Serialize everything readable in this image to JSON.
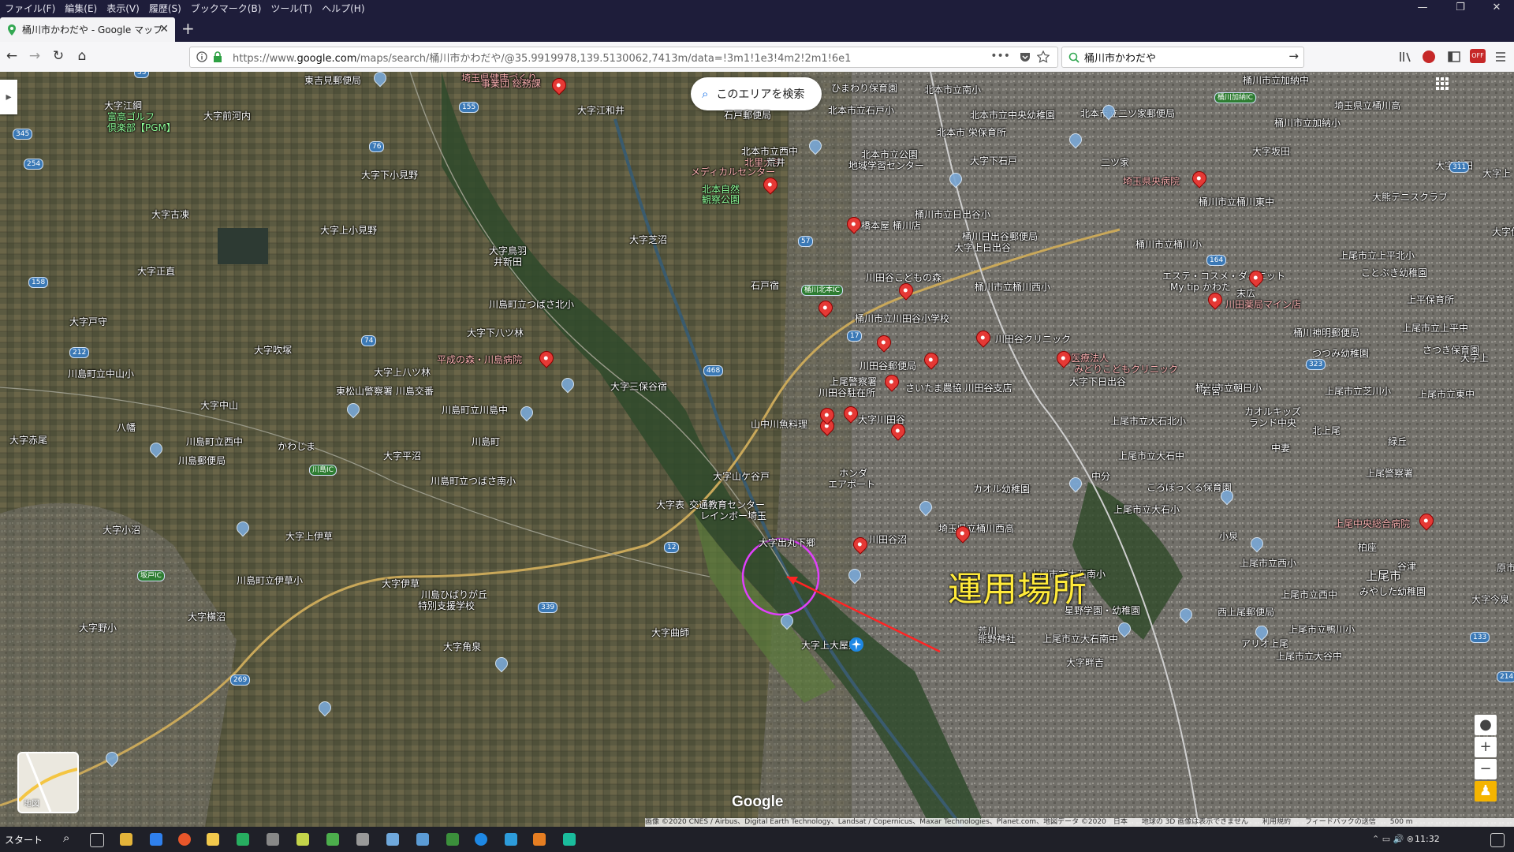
{
  "menu": [
    "ファイル(F)",
    "編集(E)",
    "表示(V)",
    "履歴(S)",
    "ブックマーク(B)",
    "ツール(T)",
    "ヘルプ(H)"
  ],
  "window_controls": {
    "minimize": "—",
    "restore": "❐",
    "close": "✕"
  },
  "tab": {
    "title": "桶川市かわだや - Google マップ",
    "close": "✕",
    "new_tab": "+"
  },
  "nav": {
    "back": "←",
    "forward": "→",
    "reload": "↻",
    "home": "⌂"
  },
  "address": {
    "url_prefix": "https://www.",
    "url_domain": "google.com",
    "url_rest": "/maps/search/桶川市かわだや/@35.9919978,139.5130062,7413m/data=!3m1!1e3!4m2!2m1!6e1"
  },
  "search": {
    "value": "桶川市かわだや",
    "go": "→"
  },
  "map": {
    "search_area_button": "このエリアを検索",
    "annotation": "運用場所",
    "google": "Google",
    "layer_label": "地図",
    "attribution": "画像 ©2020 CNES / Airbus、Digital Earth Technology、Landsat / Copernicus、Maxar Technologies、Planet.com、地図データ ©2020　日本　　地球の 3D 画像は表示できません　　利用規約　　フィードバックの送信　　500 m",
    "zoom_in": "+",
    "zoom_out": "−",
    "labels": [
      {
        "t": "東吉見郵便局"
      },
      {
        "t": "埼玉県健康づくり"
      },
      {
        "t": "事業団 総務課"
      },
      {
        "t": "大字江綱"
      },
      {
        "t": "富高ゴルフ"
      },
      {
        "t": "倶楽部【PGM】"
      },
      {
        "t": "大字前河内"
      },
      {
        "t": "大字江和井"
      },
      {
        "t": "石戸郵便局"
      },
      {
        "t": "北本市立石戸小"
      },
      {
        "t": "北本市立西中"
      },
      {
        "t": "北里大学"
      },
      {
        "t": "メディカルセンター"
      },
      {
        "t": "北本自然"
      },
      {
        "t": "観察公園"
      },
      {
        "t": "大字下小見野"
      },
      {
        "t": "大字古凍"
      },
      {
        "t": "大字上小見野"
      },
      {
        "t": "大字鳥羽"
      },
      {
        "t": "井新田"
      },
      {
        "t": "大字芝沼"
      },
      {
        "t": "橋本屋 桶川店"
      },
      {
        "t": "大字正直"
      },
      {
        "t": "川島町立つばさ北小"
      },
      {
        "t": "大字下八ツ林"
      },
      {
        "t": "平成の森・川島病院"
      },
      {
        "t": "大字戸守"
      },
      {
        "t": "大字吹塚"
      },
      {
        "t": "大字上八ツ林"
      },
      {
        "t": "川島町立中山小"
      },
      {
        "t": "東松山警察署 川島交番"
      },
      {
        "t": "大字中山"
      },
      {
        "t": "川島町立川島中"
      },
      {
        "t": "大字三保谷宿"
      },
      {
        "t": "山中川魚料理"
      },
      {
        "t": "大字赤尾"
      },
      {
        "t": "川島町立西中"
      },
      {
        "t": "かわじま"
      },
      {
        "t": "川島郵便局"
      },
      {
        "t": "大字平沼"
      },
      {
        "t": "川島町"
      },
      {
        "t": "川島町立つばさ南小"
      },
      {
        "t": "大字山ケ谷戸"
      },
      {
        "t": "大字表"
      },
      {
        "t": "交通教育センター"
      },
      {
        "t": "レインボー埼玉"
      },
      {
        "t": "ホンダ"
      },
      {
        "t": "エアポート"
      },
      {
        "t": "大字小沼"
      },
      {
        "t": "大字上伊草"
      },
      {
        "t": "大字出丸下郷"
      },
      {
        "t": "川田谷沼"
      },
      {
        "t": "川島町立伊草小"
      },
      {
        "t": "大字伊草"
      },
      {
        "t": "川島ひばりが丘"
      },
      {
        "t": "特別支援学校"
      },
      {
        "t": "大字横沼"
      },
      {
        "t": "大字曲師"
      },
      {
        "t": "大字上大屋敷"
      },
      {
        "t": "大字角泉"
      },
      {
        "t": "大字野小"
      },
      {
        "t": "北本市立公園"
      },
      {
        "t": "地域学習センター"
      },
      {
        "t": "北本市 栄保育所"
      },
      {
        "t": "北本市立中央幼稚園"
      },
      {
        "t": "北本市立南小"
      },
      {
        "t": "北本市立二ツ家郵便局"
      },
      {
        "t": "ひまわり保育園"
      },
      {
        "t": "大字下石戸"
      },
      {
        "t": "桶川市立日出谷小"
      },
      {
        "t": "桶川日出谷郵便局"
      },
      {
        "t": "大字上日出谷"
      },
      {
        "t": "川田谷こどもの森"
      },
      {
        "t": "桶川市立桶川西小"
      },
      {
        "t": "桶川市立川田谷小学校"
      },
      {
        "t": "川田谷クリニック"
      },
      {
        "t": "川田谷郵便局"
      },
      {
        "t": "上尾警察署"
      },
      {
        "t": "川田谷駐在所"
      },
      {
        "t": "さいたま農協 川田谷支店"
      },
      {
        "t": "大字川田谷"
      },
      {
        "t": "埼玉県立桶川西高"
      },
      {
        "t": "カオル幼稚園"
      },
      {
        "t": "熊野神社"
      },
      {
        "t": "医療法人"
      },
      {
        "t": "みどりこどもクリニック"
      },
      {
        "t": "大字下日出谷"
      },
      {
        "t": "桶川市立桶川小"
      },
      {
        "t": "埼玉県央病院"
      },
      {
        "t": "エステ・コスメ・ダイエット"
      },
      {
        "t": "My tip かわた"
      },
      {
        "t": "川田薬局マイン店"
      },
      {
        "t": "桶川神明郵便局"
      },
      {
        "t": "つつみ幼稚園"
      },
      {
        "t": "桶川市立朝日小"
      },
      {
        "t": "カオルキッズ"
      },
      {
        "t": "ランド中央"
      },
      {
        "t": "上尾市立大石北小"
      },
      {
        "t": "上尾市立大石中"
      },
      {
        "t": "ころぽっくる保育園"
      },
      {
        "t": "上尾市立大石小"
      },
      {
        "t": "上尾市立大石南小"
      },
      {
        "t": "星野学園・幼稚園"
      },
      {
        "t": "上尾市立大石南中"
      },
      {
        "t": "大字畔吉"
      },
      {
        "t": "桶川市立加納中"
      },
      {
        "t": "埼玉県立桶川高"
      },
      {
        "t": "桶川市立加納小"
      },
      {
        "t": "大字坂田"
      },
      {
        "t": "大字倉田"
      },
      {
        "t": "大熊テニスクラブ"
      },
      {
        "t": "桶川市立桶川東中"
      },
      {
        "t": "上尾市立上平北小"
      },
      {
        "t": "ことぶき幼稚園"
      },
      {
        "t": "上平保育所"
      },
      {
        "t": "上尾市立上平中"
      },
      {
        "t": "さつき保育園"
      },
      {
        "t": "上尾市立芝川小"
      },
      {
        "t": "上尾市立東中"
      },
      {
        "t": "上尾警察署"
      },
      {
        "t": "上尾中央総合病院"
      },
      {
        "t": "上尾市立西小"
      },
      {
        "t": "上尾市立西中"
      },
      {
        "t": "みやした幼稚園"
      },
      {
        "t": "西上尾郵便局"
      },
      {
        "t": "上尾市立鴨川小"
      },
      {
        "t": "アリオ上尾"
      },
      {
        "t": "上尾市立大谷中"
      },
      {
        "t": "上尾市"
      },
      {
        "t": "北上尾"
      },
      {
        "t": "二ツ家"
      },
      {
        "t": "若宮"
      },
      {
        "t": "末広"
      },
      {
        "t": "大字上"
      },
      {
        "t": "石戸宿"
      },
      {
        "t": "荒井"
      },
      {
        "t": "中分"
      },
      {
        "t": "緑丘"
      },
      {
        "t": "大字伊"
      },
      {
        "t": "小泉"
      },
      {
        "t": "柏座"
      },
      {
        "t": "谷津"
      },
      {
        "t": "原市"
      },
      {
        "t": "大字今泉"
      },
      {
        "t": "八幡"
      },
      {
        "t": "大字上"
      },
      {
        "t": "荒川"
      },
      {
        "t": "中妻"
      }
    ],
    "routes": [
      "33",
      "345",
      "254",
      "76",
      "155",
      "212",
      "74",
      "158",
      "468",
      "57",
      "17",
      "164",
      "311",
      "323",
      "12",
      "339",
      "269",
      "133",
      "214"
    ],
    "green_labels": [
      "桶川北本IC",
      "桶川加納IC",
      "川島IC",
      "坂戸IC"
    ]
  },
  "taskbar": {
    "start": "スタート",
    "search": "⌕",
    "time": "11:32"
  }
}
